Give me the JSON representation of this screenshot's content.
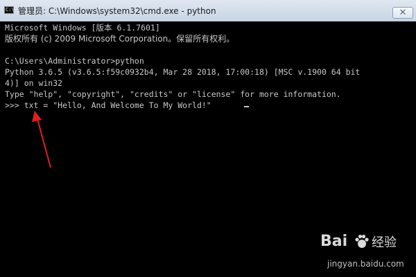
{
  "window": {
    "title": "管理员: C:\\Windows\\system32\\cmd.exe - python",
    "icon_label": "C:\\",
    "close_symbol": "✕"
  },
  "console": {
    "lines": [
      "Microsoft Windows [版本 6.1.7601]",
      "版权所有 (c) 2009 Microsoft Corporation。保留所有权利。",
      "",
      "C:\\Users\\Administrator>python",
      "Python 3.6.5 (v3.6.5:f59c0932b4, Mar 28 2018, 17:00:18) [MSC v.1900 64 bit",
      "4)] on win32",
      "Type \"help\", \"copyright\", \"credits\" or \"license\" for more information.",
      ">>> txt = \"Hello, And Welcome To My World!\""
    ]
  },
  "annotation": {
    "arrow_color": "#e02020"
  },
  "watermark": {
    "brand": "Bai",
    "brand_suffix": "经验",
    "domain": "jingyan.baidu.com"
  }
}
